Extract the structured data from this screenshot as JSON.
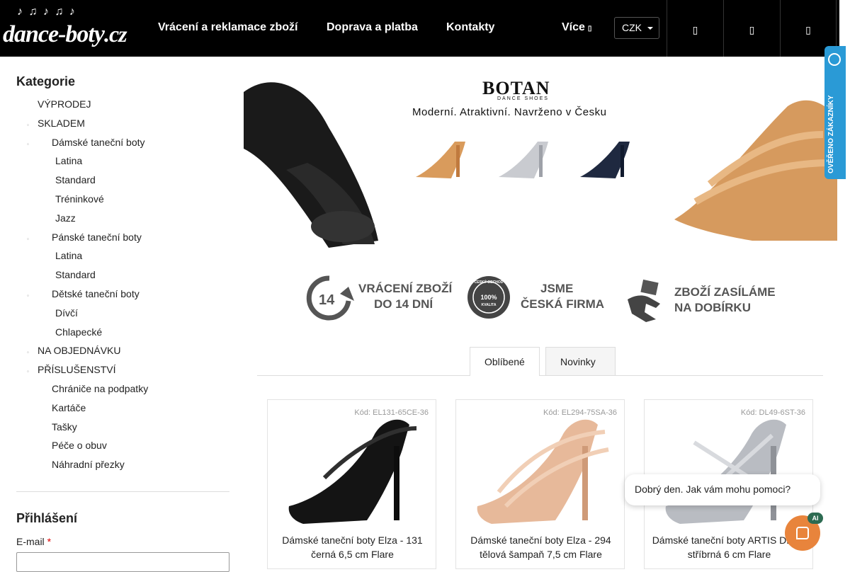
{
  "header": {
    "logo_text": "dance-boty",
    "logo_tld": ".cz",
    "nav": [
      "Vrácení a reklamace zboží",
      "Doprava a platba",
      "Kontakty"
    ],
    "more_label": "Více",
    "currency": "CZK",
    "icons": [
      "search-icon",
      "user-icon",
      "cart-icon"
    ]
  },
  "sidebar": {
    "title": "Kategorie",
    "items": [
      {
        "label": "VÝPRODEJ",
        "level": 0
      },
      {
        "label": "SKLADEM",
        "level": 0
      },
      {
        "label": "Dámské taneční boty",
        "level": 1
      },
      {
        "label": "Latina",
        "level": 2
      },
      {
        "label": "Standard",
        "level": 2
      },
      {
        "label": "Tréninkové",
        "level": 2
      },
      {
        "label": "Jazz",
        "level": 2
      },
      {
        "label": "Pánské taneční boty",
        "level": 1
      },
      {
        "label": "Latina",
        "level": 2
      },
      {
        "label": "Standard",
        "level": 2
      },
      {
        "label": "Dětské taneční boty",
        "level": 1
      },
      {
        "label": "Dívčí",
        "level": 2
      },
      {
        "label": "Chlapecké",
        "level": 2
      },
      {
        "label": "NA OBJEDNÁVKU",
        "level": 0
      },
      {
        "label": "PŘÍSLUŠENSTVÍ",
        "level": 0
      },
      {
        "label": "Chrániče na podpatky",
        "level": 1
      },
      {
        "label": "Kartáče",
        "level": 1
      },
      {
        "label": "Tašky",
        "level": 1
      },
      {
        "label": "Péče o obuv",
        "level": 1
      },
      {
        "label": "Náhradní přezky",
        "level": 1
      }
    ]
  },
  "login": {
    "title": "Přihlášení",
    "email_label": "E-mail",
    "required_mark": "*"
  },
  "banner": {
    "brand": "BOTAN",
    "brand_sub": "DANCE SHOES",
    "tagline": "Moderní. Atraktivní. Navrženo v Česku"
  },
  "badges": {
    "return_number": "14",
    "return_line1": "VRÁCENÍ ZBOŽÍ",
    "return_line2": "DO 14 DNÍ",
    "seal_top": "ČESKÝ OBCHOD",
    "seal_mid": "100%",
    "seal_bottom": "KVALITA",
    "czech_line1": "JSME",
    "czech_line2": "ČESKÁ FIRMA",
    "cod_line1": "ZBOŽÍ ZASÍLÁME",
    "cod_line2": "NA DOBÍRKU"
  },
  "tabs": [
    "Oblíbené",
    "Novinky"
  ],
  "products": [
    {
      "code": "Kód: EL131-65CE-36",
      "name": "Dámské taneční boty Elza - 131 černá 6,5 cm Flare",
      "color": "#111111"
    },
    {
      "code": "Kód: EL294-75SA-36",
      "name": "Dámské taneční boty Elza - 294 tělová šampaň 7,5 cm Flare",
      "color": "#e7b99a"
    },
    {
      "code": "Kód: DL49-6ST-36",
      "name": "Dámské taneční boty ARTIS DL-49 stříbrná 6 cm Flare",
      "color": "#b9bcc2"
    }
  ],
  "verified": {
    "label": "OVĚŘENO ZÁKAZNÍKY"
  },
  "chat": {
    "greeting": "Dobrý den. Jak vám mohu pomoci?",
    "badge": "AI"
  }
}
